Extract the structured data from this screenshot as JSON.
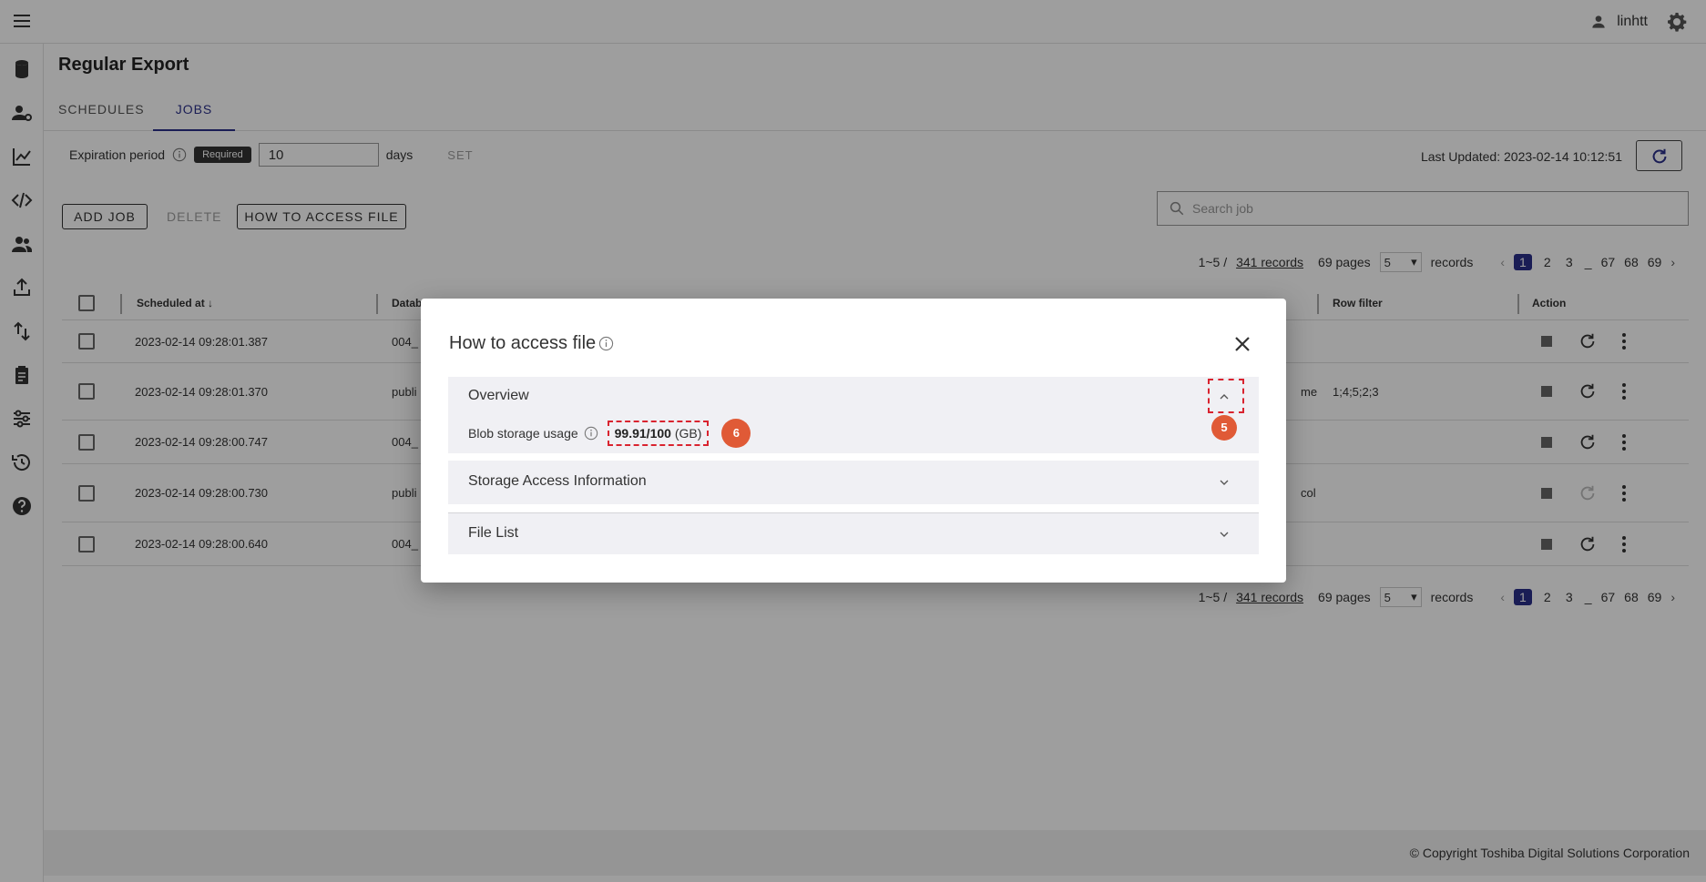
{
  "header": {
    "username": "linhtt"
  },
  "page": {
    "title": "Regular Export",
    "tabs": [
      {
        "label": "SCHEDULES"
      },
      {
        "label": "JOBS"
      }
    ]
  },
  "expiration": {
    "label": "Expiration period",
    "required_badge": "Required",
    "value": "10",
    "unit": "days",
    "set_label": "SET"
  },
  "last_updated": "Last Updated: 2023-02-14 10:12:51",
  "toolbar": {
    "add_job": "ADD JOB",
    "delete": "DELETE",
    "how_to_access": "HOW TO ACCESS FILE",
    "search_placeholder": "Search job"
  },
  "pagination": {
    "range": "1~5 /",
    "records_link": "341 records",
    "pages": "69 pages",
    "per_page": "5",
    "records_suffix": "records",
    "page_numbers": [
      "1",
      "2",
      "3"
    ],
    "ellipsis": "_",
    "tail_pages": [
      "67",
      "68",
      "69"
    ]
  },
  "table": {
    "columns": {
      "scheduled_at": "Scheduled at",
      "database": "Datab",
      "row_filter": "Row filter",
      "action": "Action"
    },
    "rows": [
      {
        "scheduled_at": "2023-02-14 09:28:01.387",
        "database": "004_",
        "extra": "",
        "row_filter": ""
      },
      {
        "scheduled_at": "2023-02-14 09:28:01.370",
        "database": "publi",
        "extra": "me",
        "row_filter": "1;4;5;2;3"
      },
      {
        "scheduled_at": "2023-02-14 09:28:00.747",
        "database": "004_",
        "extra": "",
        "row_filter": ""
      },
      {
        "scheduled_at": "2023-02-14 09:28:00.730",
        "database": "publi",
        "extra": "col",
        "row_filter": ""
      },
      {
        "scheduled_at": "2023-02-14 09:28:00.640",
        "database": "004_",
        "extra": "",
        "row_filter": ""
      }
    ]
  },
  "dialog": {
    "title": "How to access file",
    "sections": {
      "overview": "Overview",
      "storage": "Storage Access Information",
      "files": "File List"
    },
    "blob_label": "Blob storage usage",
    "blob_usage": "99.91/100",
    "blob_unit": "(GB)",
    "marker_usage": "6",
    "marker_collapse": "5"
  },
  "footer": {
    "copyright": "© Copyright Toshiba Digital Solutions Corporation"
  },
  "colors": {
    "primary": "#2b2f8a",
    "annotation": "#d9232f",
    "marker": "#e05a36"
  }
}
